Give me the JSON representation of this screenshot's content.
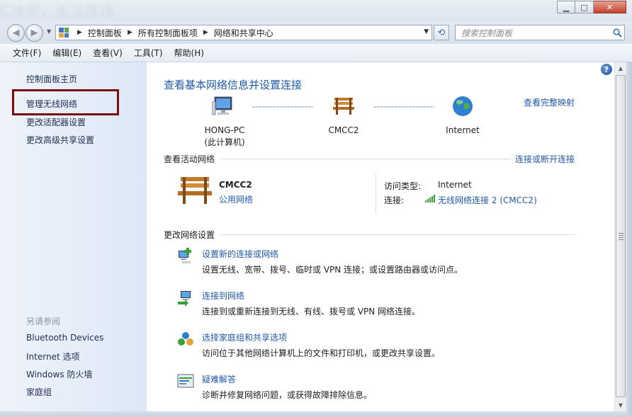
{
  "window": {
    "ghost_title": "C冲突，无法连接",
    "minimize_glyph": "▁",
    "maximize_glyph": "□",
    "close_glyph": "✕"
  },
  "address_bar": {
    "breadcrumbs": [
      "控制面板",
      "所有控制面板项",
      "网络和共享中心"
    ],
    "separator": "▶",
    "search_placeholder": "搜索控制面板"
  },
  "menu": {
    "items": [
      "文件(F)",
      "编辑(E)",
      "查看(V)",
      "工具(T)",
      "帮助(H)"
    ]
  },
  "sidebar": {
    "links": [
      "控制面板主页",
      "管理无线网络",
      "更改适配器设置",
      "更改高级共享设置"
    ],
    "see_also_label": "另请参阅",
    "see_also": [
      "Bluetooth Devices",
      "Internet 选项",
      "Windows 防火墙",
      "家庭组"
    ]
  },
  "main": {
    "title": "查看基本网络信息并设置连接",
    "full_map_link": "查看完整映射",
    "nodes": [
      {
        "label": "HONG-PC",
        "sub": "(此计算机)",
        "icon": "computer-icon"
      },
      {
        "label": "CMCC2",
        "sub": "",
        "icon": "bench-icon"
      },
      {
        "label": "Internet",
        "sub": "",
        "icon": "globe-icon"
      }
    ],
    "active_networks_label": "查看活动网络",
    "connect_disconnect_link": "连接或断开连接",
    "active_network": {
      "name": "CMCC2",
      "type": "公用网络",
      "access_type_label": "访问类型:",
      "access_type_value": "Internet",
      "connection_label": "连接:",
      "connection_value": "无线网络连接 2 (CMCC2)"
    },
    "change_settings_label": "更改网络设置",
    "tasks": [
      {
        "title": "设置新的连接或网络",
        "desc": "设置无线、宽带、拨号、临时或 VPN 连接；或设置路由器或访问点。",
        "icon": "new-connection-icon"
      },
      {
        "title": "连接到网络",
        "desc": "连接到或重新连接到无线、有线、拨号或 VPN 网络连接。",
        "icon": "connect-network-icon"
      },
      {
        "title": "选择家庭组和共享选项",
        "desc": "访问位于其他网络计算机上的文件和打印机，或更改共享设置。",
        "icon": "homegroup-icon"
      },
      {
        "title": "疑难解答",
        "desc": "诊断并修复网络问题，或获得故障排除信息。",
        "icon": "troubleshoot-icon"
      }
    ]
  },
  "colors": {
    "link": "#1f5aa8",
    "highlight_box": "#7a0c0c",
    "sidebar_bg": "#e4ecf7"
  }
}
